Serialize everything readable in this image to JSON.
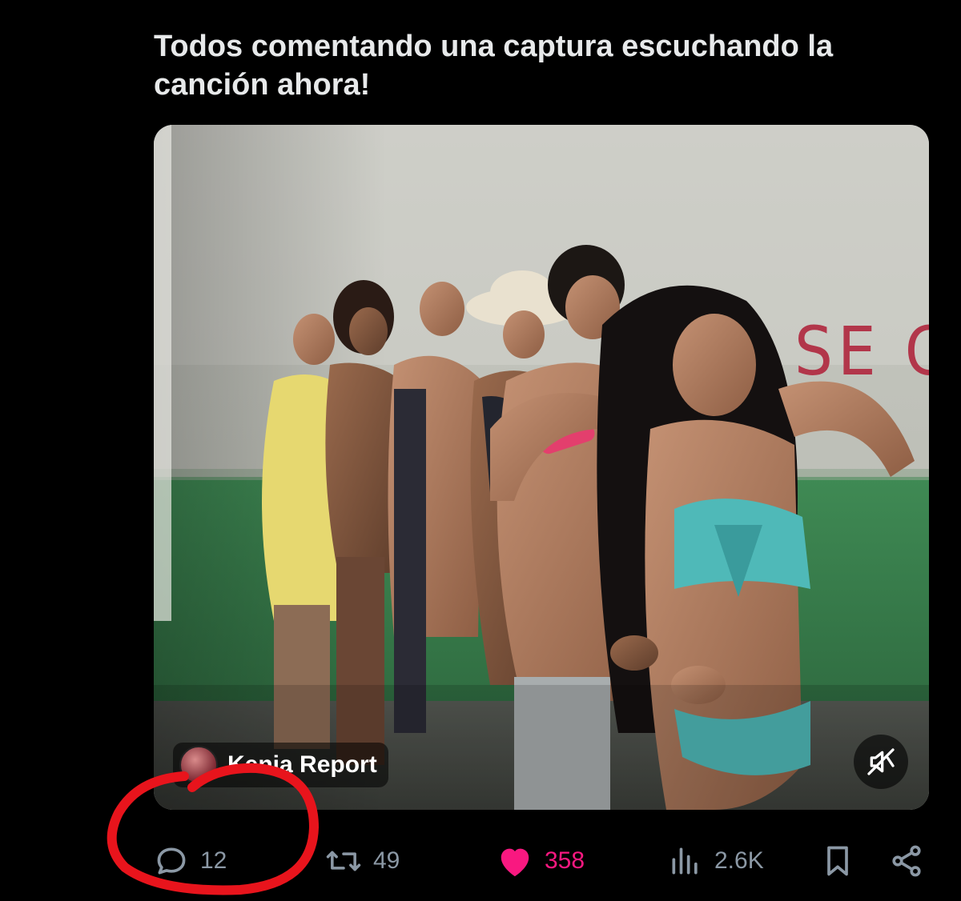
{
  "tweet": {
    "text": "Todos comentando una captura escuchando la canción ahora!"
  },
  "media": {
    "wall_text": "SE C",
    "source_label": "Kenia Report",
    "mute_icon": "speaker-muted-icon"
  },
  "actions": {
    "reply_count": "12",
    "retweet_count": "49",
    "like_count": "358",
    "views_count": "2.6K"
  },
  "colors": {
    "background": "#000000",
    "text": "#e7e9ea",
    "muted": "#8b98a5",
    "like": "#f91880",
    "annotation": "#e8141c"
  }
}
